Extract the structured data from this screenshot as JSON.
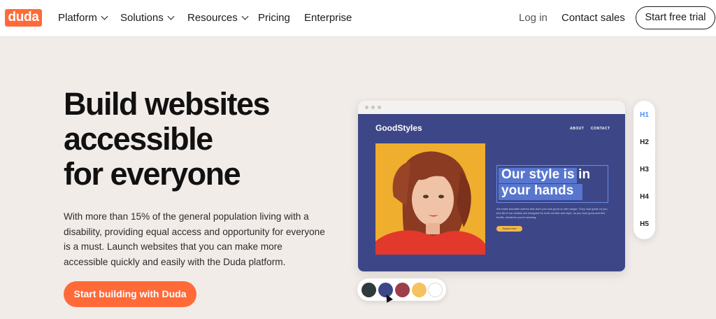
{
  "nav": {
    "logo": "duda",
    "items": [
      {
        "label": "Platform",
        "has_dropdown": true
      },
      {
        "label": "Solutions",
        "has_dropdown": true
      },
      {
        "label": "Resources",
        "has_dropdown": true
      },
      {
        "label": "Pricing",
        "has_dropdown": false
      },
      {
        "label": "Enterprise",
        "has_dropdown": false
      }
    ],
    "login": "Log in",
    "contact": "Contact sales",
    "trial": "Start free trial"
  },
  "hero": {
    "title_lines": [
      "Build websites",
      "accessible",
      "for everyone"
    ],
    "description": "With more than 15% of the general population living with a disability, providing equal access and opportunity for everyone is a must. Launch websites that you can make more accessible quickly and easily with the Duda platform.",
    "cta": "Start building with Duda"
  },
  "mockup": {
    "site_name": "GoodStyles",
    "links": [
      "ABOUT",
      "CONTACT"
    ],
    "headline": "Our style is in your hands",
    "small_copy": "We make beautiful clothes that don't just look good on the hanger. They look great on you, too! All of our clothes are designed for both comfort and style, so you look good and feel terrific, whatever you're wearing.",
    "button": "Explore Now"
  },
  "heading_panel": {
    "items": [
      "H1",
      "H2",
      "H3",
      "H4",
      "H5"
    ],
    "active": "H1"
  },
  "swatches": [
    "#2f3a3b",
    "#3d4787",
    "#9c3f4a",
    "#f6c25f",
    "#ffffff"
  ],
  "colors": {
    "brand": "#ff6a38",
    "mockup_bg": "#3d4787",
    "hero_bg": "#f2ece9",
    "active_heading": "#4a8ef0"
  }
}
